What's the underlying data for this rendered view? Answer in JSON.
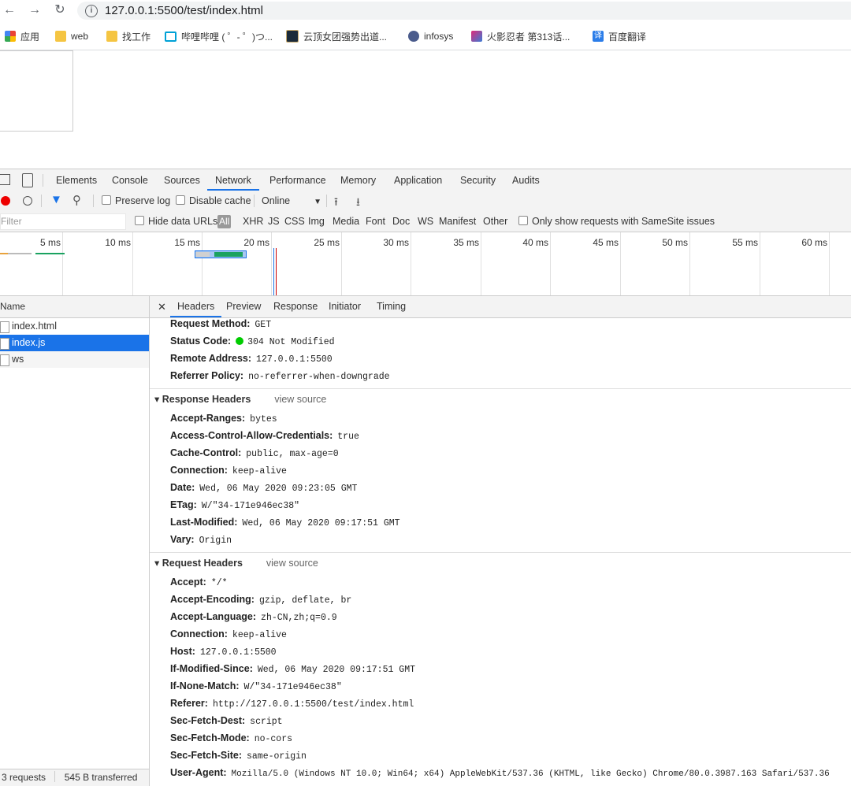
{
  "browser": {
    "url": "127.0.0.1:5500/test/index.html",
    "bookmarks": [
      {
        "label": "应用",
        "icon": "apps-grid-icon"
      },
      {
        "label": "web",
        "icon": "folder-icon"
      },
      {
        "label": "找工作",
        "icon": "folder-icon"
      },
      {
        "label": "哔哩哔哩 ( ゜- ゜)つ...",
        "icon": "bilibili-icon"
      },
      {
        "label": "云顶女团强势出道...",
        "icon": "lol-icon"
      },
      {
        "label": "infosys",
        "icon": "infosys-icon"
      },
      {
        "label": "火影忍者 第313话...",
        "icon": "video-icon"
      },
      {
        "label": "百度翻译",
        "icon": "translate-icon"
      }
    ]
  },
  "devtools": {
    "tabs": [
      "Elements",
      "Console",
      "Sources",
      "Network",
      "Performance",
      "Memory",
      "Application",
      "Security",
      "Audits"
    ],
    "active_tab": "Network",
    "toolbar": {
      "preserve_log": "Preserve log",
      "disable_cache": "Disable cache",
      "throttle": "Online"
    },
    "filter": {
      "placeholder": "Filter",
      "hide_data_urls": "Hide data URLs",
      "types": [
        "All",
        "XHR",
        "JS",
        "CSS",
        "Img",
        "Media",
        "Font",
        "Doc",
        "WS",
        "Manifest",
        "Other"
      ],
      "samesite": "Only show requests with SameSite issues"
    },
    "timeline_labels": [
      "5 ms",
      "10 ms",
      "15 ms",
      "20 ms",
      "25 ms",
      "30 ms",
      "35 ms",
      "40 ms",
      "45 ms",
      "50 ms",
      "55 ms",
      "60 ms"
    ],
    "requests": {
      "header": "Name",
      "items": [
        "index.html",
        "index.js",
        "ws"
      ],
      "selected": "index.js"
    },
    "detail_tabs": [
      "Headers",
      "Preview",
      "Response",
      "Initiator",
      "Timing"
    ],
    "general": [
      {
        "k": "Request Method:",
        "v": "GET"
      },
      {
        "k": "Status Code:",
        "v": "304 Not Modified"
      },
      {
        "k": "Remote Address:",
        "v": "127.0.0.1:5500"
      },
      {
        "k": "Referrer Policy:",
        "v": "no-referrer-when-downgrade"
      }
    ],
    "response_headers_title": "Response Headers",
    "view_source": "view source",
    "response_headers": [
      {
        "k": "Accept-Ranges:",
        "v": "bytes"
      },
      {
        "k": "Access-Control-Allow-Credentials:",
        "v": "true"
      },
      {
        "k": "Cache-Control:",
        "v": "public, max-age=0"
      },
      {
        "k": "Connection:",
        "v": "keep-alive"
      },
      {
        "k": "Date:",
        "v": "Wed, 06 May 2020 09:23:05 GMT"
      },
      {
        "k": "ETag:",
        "v": "W/\"34-171e946ec38\""
      },
      {
        "k": "Last-Modified:",
        "v": "Wed, 06 May 2020 09:17:51 GMT"
      },
      {
        "k": "Vary:",
        "v": "Origin"
      }
    ],
    "request_headers_title": "Request Headers",
    "request_headers": [
      {
        "k": "Accept:",
        "v": "*/*"
      },
      {
        "k": "Accept-Encoding:",
        "v": "gzip, deflate, br"
      },
      {
        "k": "Accept-Language:",
        "v": "zh-CN,zh;q=0.9"
      },
      {
        "k": "Connection:",
        "v": "keep-alive"
      },
      {
        "k": "Host:",
        "v": "127.0.0.1:5500"
      },
      {
        "k": "If-Modified-Since:",
        "v": "Wed, 06 May 2020 09:17:51 GMT"
      },
      {
        "k": "If-None-Match:",
        "v": "W/\"34-171e946ec38\""
      },
      {
        "k": "Referer:",
        "v": "http://127.0.0.1:5500/test/index.html"
      },
      {
        "k": "Sec-Fetch-Dest:",
        "v": "script"
      },
      {
        "k": "Sec-Fetch-Mode:",
        "v": "no-cors"
      },
      {
        "k": "Sec-Fetch-Site:",
        "v": "same-origin"
      },
      {
        "k": "User-Agent:",
        "v": "Mozilla/5.0 (Windows NT 10.0; Win64; x64) AppleWebKit/537.36 (KHTML, like Gecko) Chrome/80.0.3987.163 Safari/537.36"
      }
    ],
    "status": {
      "requests": "3 requests",
      "transferred": "545 B transferred"
    }
  }
}
